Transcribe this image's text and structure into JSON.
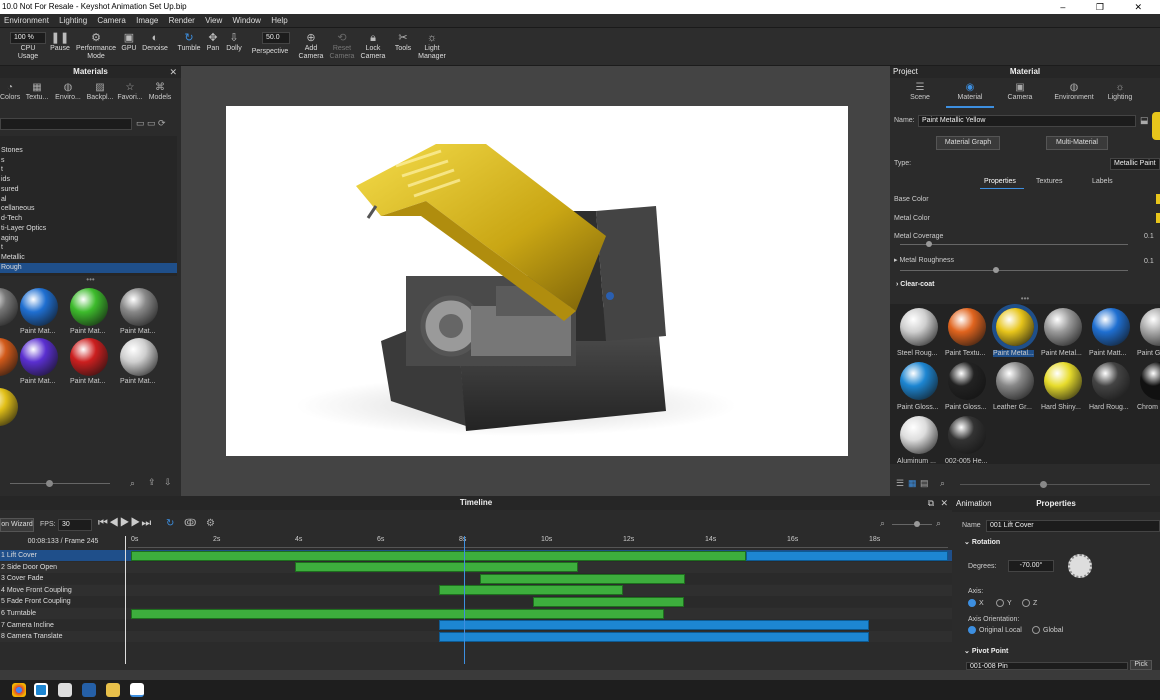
{
  "window": {
    "title": "10.0 Not For Resale  - Keyshot Animation Set Up.bip",
    "controls": "–  ❐  ✕"
  },
  "menu": [
    "Environment",
    "Lighting",
    "Camera",
    "Image",
    "Render",
    "View",
    "Window",
    "Help"
  ],
  "toolbar": {
    "zoom": "100 %",
    "cpu_label": "CPU Usage",
    "pause_label": "Pause",
    "performance_label": "Performance Mode",
    "gpu_label": "GPU",
    "denoise_label": "Denoise",
    "tumble_label": "Tumble",
    "pan_label": "Pan",
    "dolly_label": "Dolly",
    "fov_value": "50.0",
    "perspective_label": "Perspective",
    "add_camera_label": "Add Camera",
    "reset_camera_label": "Reset Camera",
    "lock_camera_label": "Lock Camera",
    "tools_label": "Tools",
    "light_manager_label": "Light Manager"
  },
  "library": {
    "title": "Materials",
    "tabs": [
      "Colors",
      "Textu...",
      "Enviro...",
      "Backpl...",
      "Favori...",
      "Models"
    ],
    "tree": [
      "",
      "Stones",
      "s",
      "t",
      "ids",
      "sured",
      "al",
      "cellaneous",
      "d-Tech",
      "ti-Layer Optics",
      "aging",
      "t",
      "Metallic",
      "Rough"
    ],
    "selected_tree": "Rough",
    "thumbs": [
      "",
      "Paint Mat...",
      "Paint Mat...",
      "Paint Mat...",
      "",
      "Paint Mat...",
      "Paint Mat...",
      "Paint Mat...",
      ""
    ]
  },
  "project": {
    "title_left": "Project",
    "title": "Material",
    "tabs": [
      "Scene",
      "Material",
      "Camera",
      "Environment",
      "Lighting"
    ],
    "active_tab": "Material",
    "name_label": "Name:",
    "name_value": "Paint Metallic Yellow",
    "material_graph": "Material Graph",
    "multi_material": "Multi-Material",
    "type_label": "Type:",
    "type_value": "Metallic Paint",
    "subtabs": [
      "Properties",
      "Textures",
      "Labels"
    ],
    "base_color": "Base Color",
    "metal_color": "Metal Color",
    "metal_coverage": "Metal Coverage",
    "metal_coverage_value": "0.1",
    "metal_roughness": "Metal Roughness",
    "metal_roughness_value": "0.1",
    "clear_coat": "Clear-coat",
    "swatches": [
      "Steel Roug...",
      "Paint Textu...",
      "Paint Metal...",
      "Paint Metal...",
      "Paint Matt...",
      "Paint G",
      "Paint Gloss...",
      "Paint Gloss...",
      "Leather Gr...",
      "Hard Shiny...",
      "Hard Roug...",
      "Chrom",
      "Aluminum ...",
      "002-005 He..."
    ]
  },
  "timeline": {
    "title": "Timeline",
    "wizard": "on Wizard",
    "fps_label": "FPS:",
    "fps_value": "30",
    "time": "00:08:133 / Frame 245",
    "ticks": [
      "0s",
      "2s",
      "4s",
      "6s",
      "8s",
      "10s",
      "12s",
      "14s",
      "16s",
      "18s"
    ],
    "tracks": [
      {
        "name": "1 Lift Cover",
        "start": 0,
        "end": 15
      },
      {
        "name": "2 Side Door Open",
        "start": 4,
        "end": 10.9
      },
      {
        "name": "3 Cover Fade",
        "start": 8.5,
        "end": 13.5
      },
      {
        "name": "4 Move Front Coupling",
        "start": 7.5,
        "end": 12
      },
      {
        "name": "5 Fade Front Coupling",
        "start": 9.8,
        "end": 13.5
      },
      {
        "name": "6 Turntable",
        "start": 0,
        "end": 13
      },
      {
        "name": "7 Camera Incline",
        "start": 7.5,
        "end": 18
      },
      {
        "name": "8 Camera Translate",
        "start": 7.5,
        "end": 18
      }
    ],
    "playhead_s": 8.13
  },
  "animation": {
    "title_left": "Animation",
    "title": "Properties",
    "name_label": "Name",
    "name_value": "001 Lift Cover",
    "rotation": "Rotation",
    "degrees_label": "Degrees:",
    "degrees_value": "-70.00°",
    "axis_label": "Axis:",
    "axes": [
      "X",
      "Y",
      "Z"
    ],
    "axis_orient_label": "Axis Orientation:",
    "orient_opts": [
      "Original Local",
      "Global"
    ],
    "pivot": "Pivot Point",
    "pivot_value": "001-008 Pin",
    "pick": "Pick"
  },
  "colors": {
    "accent": "#3d8fe0",
    "green_bar": "#3dae3d",
    "blue_bar": "#1d86d2",
    "selected": "#1f4f8a",
    "yellow": "#e7c51b"
  }
}
